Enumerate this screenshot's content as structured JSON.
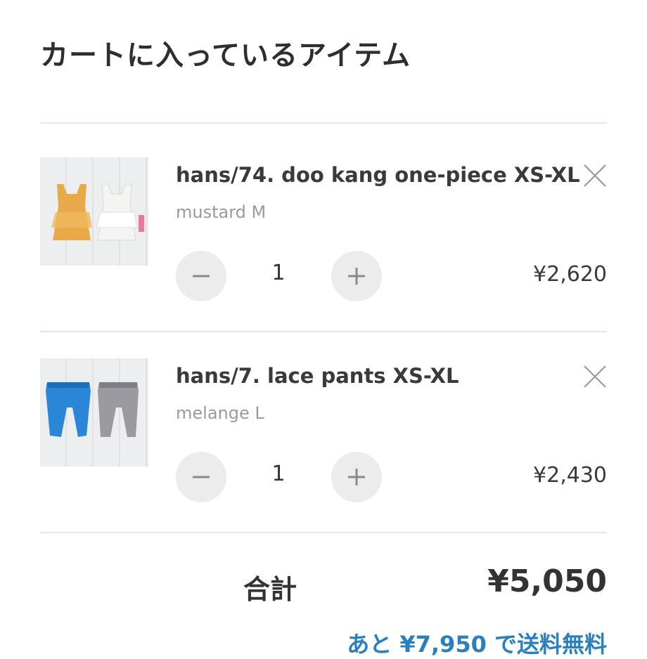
{
  "title": "カートに入っているアイテム",
  "items": [
    {
      "name": "hans/74. doo kang one-piece XS-XL",
      "variant": "mustard M",
      "quantity": "1",
      "price": "¥2,620",
      "thumb_colors": [
        "#e8a948",
        "#f2f2f0"
      ]
    },
    {
      "name": "hans/7. lace pants XS-XL",
      "variant": "melange L",
      "quantity": "1",
      "price": "¥2,430",
      "thumb_colors": [
        "#2a86d6",
        "#9a9aa0"
      ]
    }
  ],
  "total": {
    "label": "合計",
    "value": "¥5,050"
  },
  "shipping_note": "あと ¥7,950 で送料無料",
  "icons": {
    "remove": "close-icon",
    "decrease": "minus-icon",
    "increase": "plus-icon"
  },
  "colors": {
    "link": "#2a7fbf",
    "qty_button": "#ececec",
    "divider": "#e6e6e6"
  }
}
